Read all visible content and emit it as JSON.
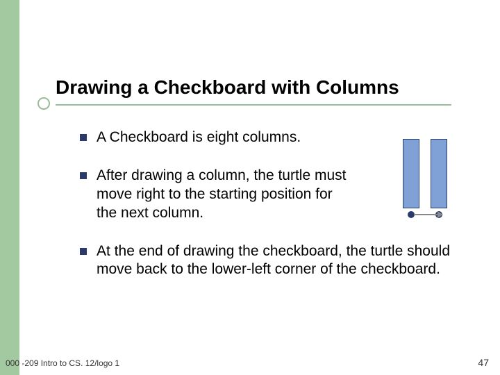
{
  "title": "Drawing a Checkboard with Columns",
  "bullets": [
    "A Checkboard is eight columns.",
    "After drawing a column, the turtle must move right to the starting position for the next column.",
    "At the end of drawing the checkboard, the turtle should move back to the lower-left corner of the checkboard."
  ],
  "footer": {
    "left": "000 -209 Intro to CS. 12/logo 1",
    "right": "47"
  },
  "colors": {
    "sidebar": "#a3c9a1",
    "rule": "#99bb99",
    "bullet": "#2a3a6a",
    "column_fill": "#7fa1d6",
    "arrow": "#888888"
  }
}
